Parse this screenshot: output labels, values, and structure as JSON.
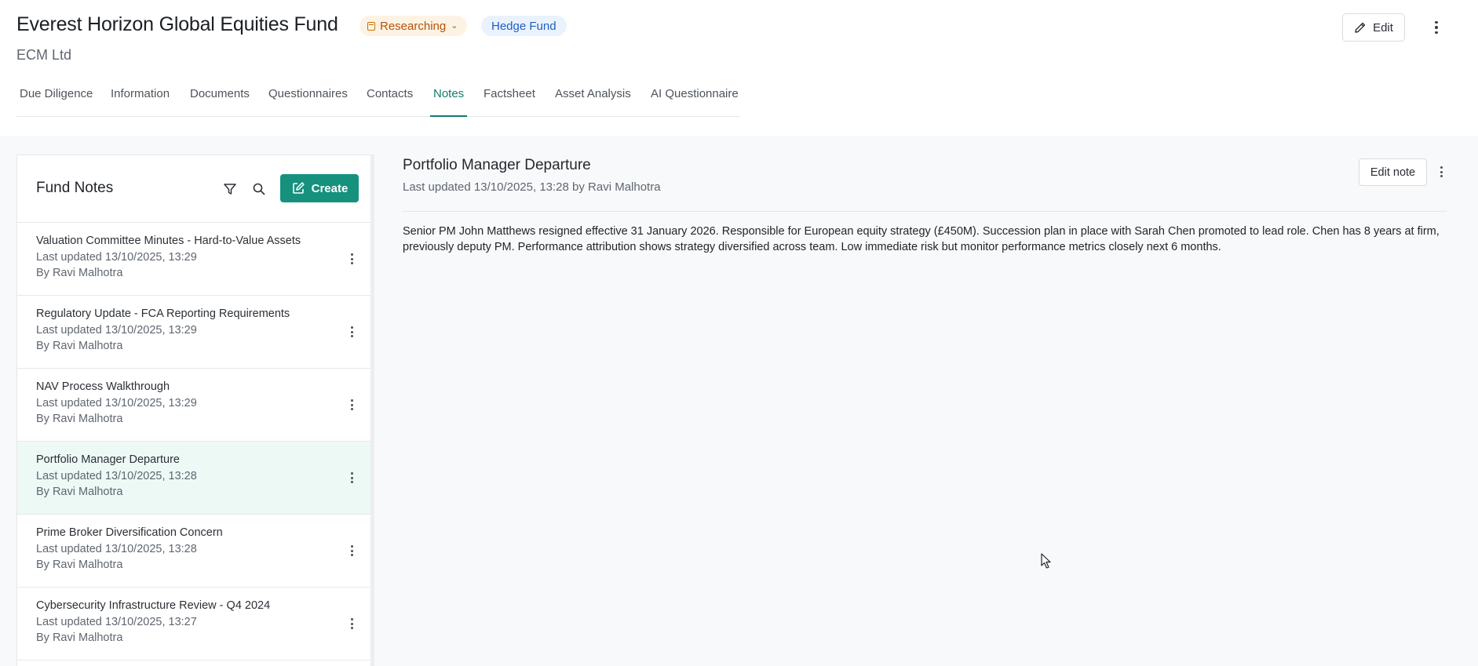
{
  "header": {
    "fund_name": "Everest Horizon Global Equities Fund",
    "status": "Researching",
    "fund_type": "Hedge Fund",
    "manager": "ECM Ltd",
    "edit_label": "Edit"
  },
  "tabs": [
    {
      "label": "Due Diligence"
    },
    {
      "label": "Information"
    },
    {
      "label": "Documents"
    },
    {
      "label": "Questionnaires"
    },
    {
      "label": "Contacts"
    },
    {
      "label": "Notes",
      "active": true
    },
    {
      "label": "Factsheet"
    },
    {
      "label": "Asset Analysis"
    },
    {
      "label": "AI Questionnaire"
    }
  ],
  "notes_panel": {
    "title": "Fund Notes",
    "create_label": "Create",
    "items": [
      {
        "title": "Valuation Committee Minutes - Hard-to-Value Assets",
        "updated": "Last updated 13/10/2025, 13:29",
        "by": "By Ravi Malhotra"
      },
      {
        "title": "Regulatory Update - FCA Reporting Requirements",
        "updated": "Last updated 13/10/2025, 13:29",
        "by": "By Ravi Malhotra"
      },
      {
        "title": "NAV Process Walkthrough",
        "updated": "Last updated 13/10/2025, 13:29",
        "by": "By Ravi Malhotra"
      },
      {
        "title": "Portfolio Manager Departure",
        "updated": "Last updated 13/10/2025, 13:28",
        "by": "By Ravi Malhotra",
        "selected": true
      },
      {
        "title": "Prime Broker Diversification Concern",
        "updated": "Last updated 13/10/2025, 13:28",
        "by": "By Ravi Malhotra"
      },
      {
        "title": "Cybersecurity Infrastructure Review - Q4 2024",
        "updated": "Last updated 13/10/2025, 13:27",
        "by": "By Ravi Malhotra"
      }
    ]
  },
  "detail": {
    "title": "Portfolio Manager Departure",
    "meta": "Last updated 13/10/2025, 13:28 by Ravi Malhotra",
    "edit_label": "Edit note",
    "body": "Senior PM John Matthews resigned effective 31 January 2026. Responsible for European equity strategy (£450M). Succession plan in place with Sarah Chen promoted to lead role. Chen has 8 years at firm, previously deputy PM. Performance attribution shows strategy diversified across team. Low immediate risk but monitor performance metrics closely next 6 months."
  },
  "colors": {
    "accent": "#137a69",
    "create_button": "#15917e",
    "status_bg": "#fdf3e4",
    "status_text": "#b45309",
    "type_bg": "#eaf2fd",
    "type_text": "#1d5fc4",
    "selected_row": "#edf9f5"
  }
}
